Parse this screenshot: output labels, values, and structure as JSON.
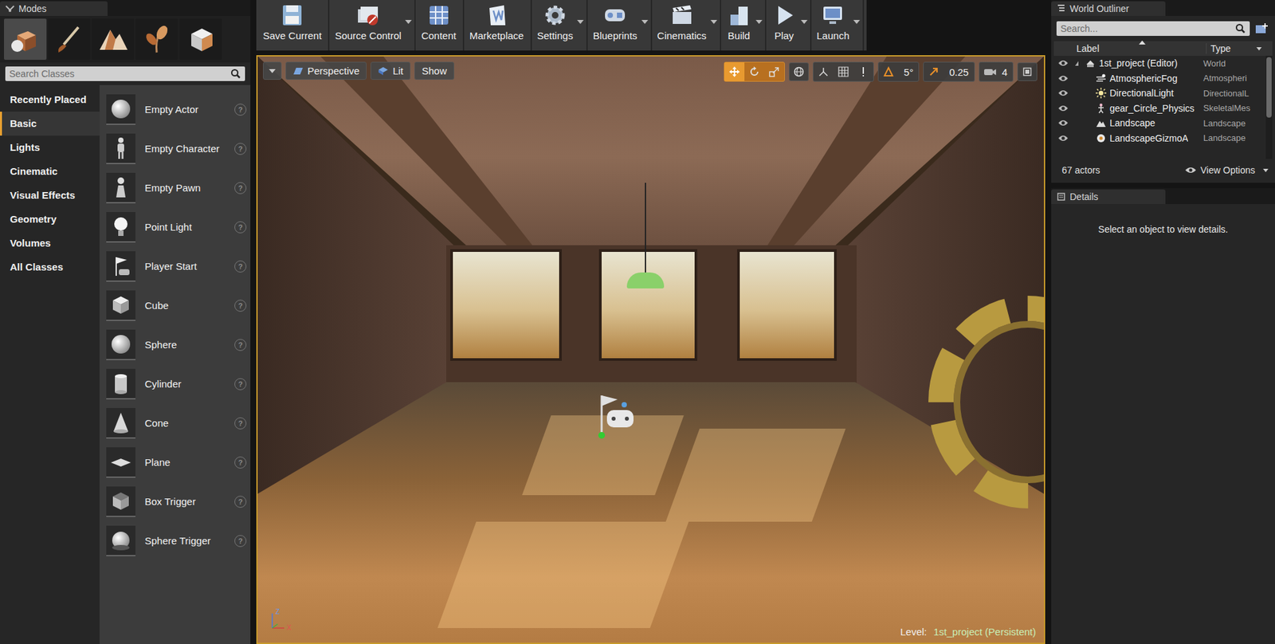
{
  "modes_panel": {
    "title": "Modes",
    "mode_tabs": [
      {
        "kind": "place",
        "selected": true
      },
      {
        "kind": "paint",
        "selected": false
      },
      {
        "kind": "landscape",
        "selected": false
      },
      {
        "kind": "foliage",
        "selected": false
      },
      {
        "kind": "geometry",
        "selected": false
      }
    ],
    "search": {
      "placeholder": "Search Classes"
    },
    "categories": [
      {
        "label": "Recently Placed",
        "selected": false
      },
      {
        "label": "Basic",
        "selected": true
      },
      {
        "label": "Lights",
        "selected": false
      },
      {
        "label": "Cinematic",
        "selected": false
      },
      {
        "label": "Visual Effects",
        "selected": false
      },
      {
        "label": "Geometry",
        "selected": false
      },
      {
        "label": "Volumes",
        "selected": false
      },
      {
        "label": "All Classes",
        "selected": false
      }
    ],
    "help_glyph": "?",
    "items": [
      {
        "label": "Empty Actor",
        "kind": "actor"
      },
      {
        "label": "Empty Character",
        "kind": "character"
      },
      {
        "label": "Empty Pawn",
        "kind": "pawn"
      },
      {
        "label": "Point Light",
        "kind": "light"
      },
      {
        "label": "Player Start",
        "kind": "start"
      },
      {
        "label": "Cube",
        "kind": "cube"
      },
      {
        "label": "Sphere",
        "kind": "sphere"
      },
      {
        "label": "Cylinder",
        "kind": "cylinder"
      },
      {
        "label": "Cone",
        "kind": "cone"
      },
      {
        "label": "Plane",
        "kind": "plane"
      },
      {
        "label": "Box Trigger",
        "kind": "box-trigger"
      },
      {
        "label": "Sphere Trigger",
        "kind": "sphere-trigger"
      }
    ]
  },
  "toolbar": {
    "buttons": [
      {
        "label": "Save Current",
        "kind": "save",
        "dropdown": false
      },
      {
        "label": "Source Control",
        "kind": "source",
        "dropdown": true
      },
      {
        "label": "Content",
        "kind": "content",
        "dropdown": false
      },
      {
        "label": "Marketplace",
        "kind": "market",
        "dropdown": false
      },
      {
        "label": "Settings",
        "kind": "settings",
        "dropdown": true
      },
      {
        "label": "Blueprints",
        "kind": "blueprints",
        "dropdown": true
      },
      {
        "label": "Cinematics",
        "kind": "cinematics",
        "dropdown": true
      },
      {
        "label": "Build",
        "kind": "build",
        "dropdown": true
      },
      {
        "label": "Play",
        "kind": "play",
        "dropdown": true
      },
      {
        "label": "Launch",
        "kind": "launch",
        "dropdown": true
      }
    ]
  },
  "viewport": {
    "view_mode": "Perspective",
    "lighting": "Lit",
    "show": "Show",
    "transform_tools": [
      {
        "kind": "move",
        "selected": true
      },
      {
        "kind": "rotate",
        "selected": false
      },
      {
        "kind": "scale",
        "selected": false
      }
    ],
    "angle_snap": "5°",
    "scale_snap": "0.25",
    "camera_speed": "4",
    "axis_labels": [
      "Z",
      "X"
    ],
    "level_label": "Level:",
    "level_name": "1st_project (Persistent)"
  },
  "world_outliner": {
    "title": "World Outliner",
    "search": {
      "placeholder": "Search..."
    },
    "columns": [
      "Label",
      "Type"
    ],
    "rows": [
      {
        "label": "1st_project (Editor)",
        "type": "World",
        "kind": "world",
        "depth": 0,
        "expanded": true,
        "visible": true
      },
      {
        "label": "AtmosphericFog",
        "type": "Atmospheri",
        "kind": "fog",
        "depth": 1,
        "expanded": false,
        "visible": true
      },
      {
        "label": "DirectionalLight",
        "type": "DirectionalL",
        "kind": "light",
        "depth": 1,
        "expanded": false,
        "visible": true
      },
      {
        "label": "gear_Circle_Physics",
        "type": "SkeletalMes",
        "kind": "skeletal",
        "depth": 1,
        "expanded": false,
        "visible": true
      },
      {
        "label": "Landscape",
        "type": "Landscape",
        "kind": "landscape",
        "depth": 1,
        "expanded": false,
        "visible": true
      },
      {
        "label": "LandscapeGizmoA",
        "type": "Landscape",
        "kind": "gizmo",
        "depth": 1,
        "expanded": false,
        "visible": true
      }
    ],
    "actor_count": "67 actors",
    "view_options": "View Options"
  },
  "details": {
    "title": "Details",
    "message": "Select an object to view details."
  }
}
